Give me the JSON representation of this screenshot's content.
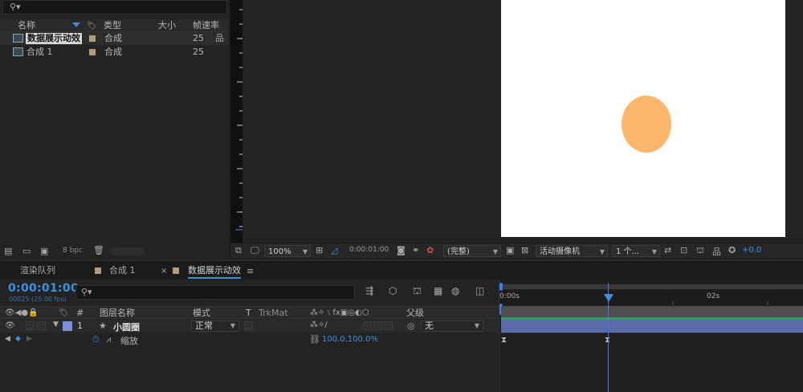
{
  "project": {
    "headers": {
      "name": "名称",
      "type": "类型",
      "size": "大小",
      "fps": "帧速率"
    },
    "rows": [
      {
        "name": "数据展示动效",
        "type": "合成",
        "fps": "25",
        "selected": true
      },
      {
        "name": "合成 1",
        "type": "合成",
        "fps": "25",
        "selected": false
      }
    ],
    "bpc": "8 bpc"
  },
  "viewer": {
    "zoom": "100%",
    "timecode": "0:00:01:00",
    "resolution": "(完整)",
    "camera": "活动摄像机",
    "views": "1 个...",
    "exposure": "+0.0",
    "shape_color": "#fcb76d"
  },
  "tabs": {
    "render_queue": "渲染队列",
    "comp1": "合成 1",
    "active": "数据展示动效"
  },
  "timeline": {
    "timecode": "0:00:01:00",
    "frame_info": "00025 (25.00 fps)",
    "columns": {
      "num": "#",
      "layer_name": "图层名称",
      "mode": "模式",
      "t": "T",
      "trkmat": "TrkMat",
      "parent": "父级"
    },
    "layer": {
      "index": "1",
      "name": "小圆圈",
      "mode": "正常",
      "parent": "无",
      "label_color": "#7a8fd8"
    },
    "property": {
      "name": "缩放",
      "value": "100.0,100.0",
      "unit": "%"
    },
    "ruler": {
      "t0": "0:00s",
      "t2": "02s"
    }
  }
}
